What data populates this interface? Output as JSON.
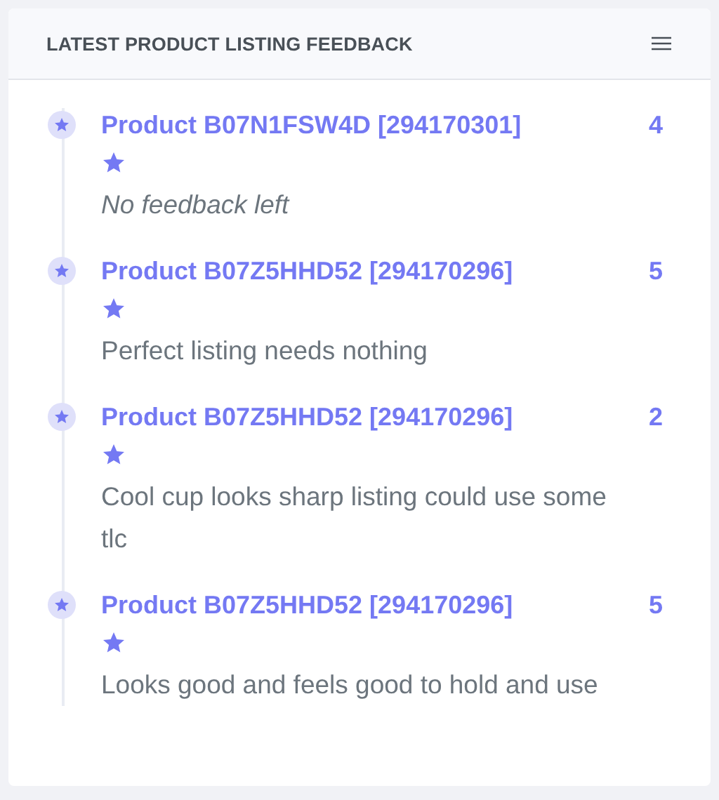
{
  "card": {
    "title": "LATEST PRODUCT LISTING FEEDBACK"
  },
  "items": [
    {
      "title": "Product B07N1FSW4D [294170301]",
      "rating": "4",
      "kind": "empty",
      "text": "No feedback left"
    },
    {
      "title": "Product B07Z5HHD52 [294170296]",
      "rating": "5",
      "kind": "comment",
      "text": "Perfect listing needs nothing"
    },
    {
      "title": "Product B07Z5HHD52 [294170296]",
      "rating": "2",
      "kind": "comment",
      "text": "Cool cup looks sharp listing could use some tlc"
    },
    {
      "title": "Product B07Z5HHD52 [294170296]",
      "rating": "5",
      "kind": "comment",
      "text": "Looks good and feels good to hold and use"
    }
  ]
}
